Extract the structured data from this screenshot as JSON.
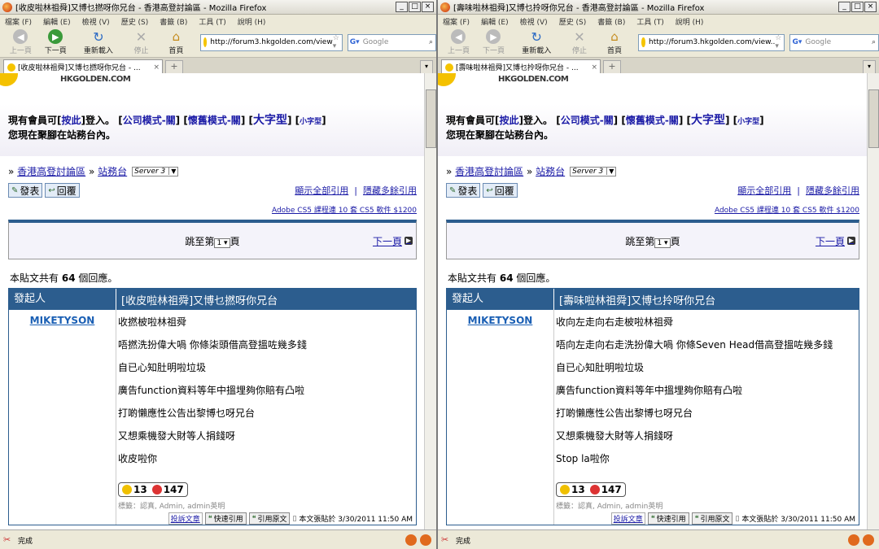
{
  "windows": [
    {
      "title": "[收皮啦林祖舜]又博乜撚呀你兄台 - 香港高登討論區 - Mozilla Firefox",
      "menu": [
        "檔案 (F)",
        "編輯 (E)",
        "檢視 (V)",
        "歷史 (S)",
        "書籤 (B)",
        "工具 (T)",
        "說明 (H)"
      ],
      "nav": {
        "back": "上一頁",
        "forward": "下一頁",
        "reload": "重新載入",
        "stop": "停止",
        "home": "首頁"
      },
      "url": "http://forum3.hkgolden.com/view",
      "search_placeholder": "Google",
      "tab_title": "[收皮啦林祖舜]又博乜撚呀你兄台 - ...",
      "logo": "HKGOLDEN.COM",
      "login_line": {
        "prefix": "現有會員可[",
        "link": "按此",
        "suffix": "]登入。",
        "mode1": "公司模式-關",
        "mode2": "懷舊模式-關",
        "big": "大字型",
        "small": "小字型"
      },
      "location_line": "您現在聚腳在站務台內。",
      "breadcrumb": {
        "home": "香港高登討論區",
        "section": "站務台",
        "server": "Server 3"
      },
      "buttons": {
        "post": "發表",
        "reply": "回覆"
      },
      "quote_links": {
        "show": "顯示全部引用",
        "hide": "隱藏多餘引用"
      },
      "ad": "Adobe CS5 課程連 10 套 CS5 軟件 $1200",
      "pager": {
        "prefix": "跳至第",
        "page": "1",
        "suffix": "頁",
        "next": "下一頁"
      },
      "reply_count": {
        "prefix": "本貼文共有",
        "count": "64",
        "suffix": "個回應。"
      },
      "post": {
        "col_author": "發起人",
        "subject": "[收皮啦林祖舜]又博乜撚呀你兄台",
        "author": "MIKETYSON",
        "lines": [
          "收撚柀啦林祖舜",
          "唔撚洗扮偉大喎 你條柒頭借高登搵咗幾多錢",
          "自已心知肚明啦垃圾",
          "廣告function資料等年中搵埋夠你賠有凸啦",
          "打啲懶應性公告出黎博乜呀兄台",
          "又想乘機發大財等人捐錢呀",
          "收皮啦你"
        ],
        "up": "13",
        "down": "147",
        "tags": "標籤：認真, Admin, admin英明",
        "report": "投訴文章",
        "quick_quote": "快速引用",
        "quote_orig": "引用原文",
        "posted": "本文張貼於 3/30/2011 11:50 AM"
      },
      "status": "完成"
    },
    {
      "title": "[壽味啦林祖舜]又博乜拎呀你兄台 - 香港高登討論區 - Mozilla Firefox",
      "menu": [
        "檔案 (F)",
        "編輯 (E)",
        "檢視 (V)",
        "歷史 (S)",
        "書籤 (B)",
        "工具 (T)",
        "說明 (H)"
      ],
      "nav": {
        "back": "上一頁",
        "forward": "下一頁",
        "reload": "重新載入",
        "stop": "停止",
        "home": "首頁"
      },
      "url": "http://forum3.hkgolden.com/view..",
      "search_placeholder": "Google",
      "tab_title": "[壽味啦林祖舜]又博乜拎呀你兄台 - ...",
      "logo": "HKGOLDEN.COM",
      "login_line": {
        "prefix": "現有會員可[",
        "link": "按此",
        "suffix": "]登入。",
        "mode1": "公司模式-關",
        "mode2": "懷舊模式-關",
        "big": "大字型",
        "small": "小字型"
      },
      "location_line": "您現在聚腳在站務台內。",
      "breadcrumb": {
        "home": "香港高登討論區",
        "section": "站務台",
        "server": "Server 3"
      },
      "buttons": {
        "post": "發表",
        "reply": "回覆"
      },
      "quote_links": {
        "show": "顯示全部引用",
        "hide": "隱藏多餘引用"
      },
      "ad": "Adobe CS5 課程連 10 套 CS5 軟件 $1200",
      "pager": {
        "prefix": "跳至第",
        "page": "1",
        "suffix": "頁",
        "next": "下一頁"
      },
      "reply_count": {
        "prefix": "本貼文共有",
        "count": "64",
        "suffix": "個回應。"
      },
      "post": {
        "col_author": "發起人",
        "subject": "[壽味啦林祖舜]又博乜拎呀你兄台",
        "author": "MIKETYSON",
        "lines": [
          "收向左走向右走柀啦林祖舜",
          "唔向左走向右走洗扮偉大喎 你條Seven Head借高登搵咗幾多錢",
          "自已心知肚明啦垃圾",
          "廣告function資料等年中搵埋夠你賠有凸啦",
          "打啲懶應性公告出黎博乜呀兄台",
          "又想乘機發大財等人捐錢呀",
          "Stop la啦你"
        ],
        "up": "13",
        "down": "147",
        "tags": "標籤：認真, Admin, admin英明",
        "report": "投訴文章",
        "quick_quote": "快速引用",
        "quote_orig": "引用原文",
        "posted": "本文張貼於 3/30/2011 11:50 AM"
      },
      "status": "完成"
    }
  ]
}
